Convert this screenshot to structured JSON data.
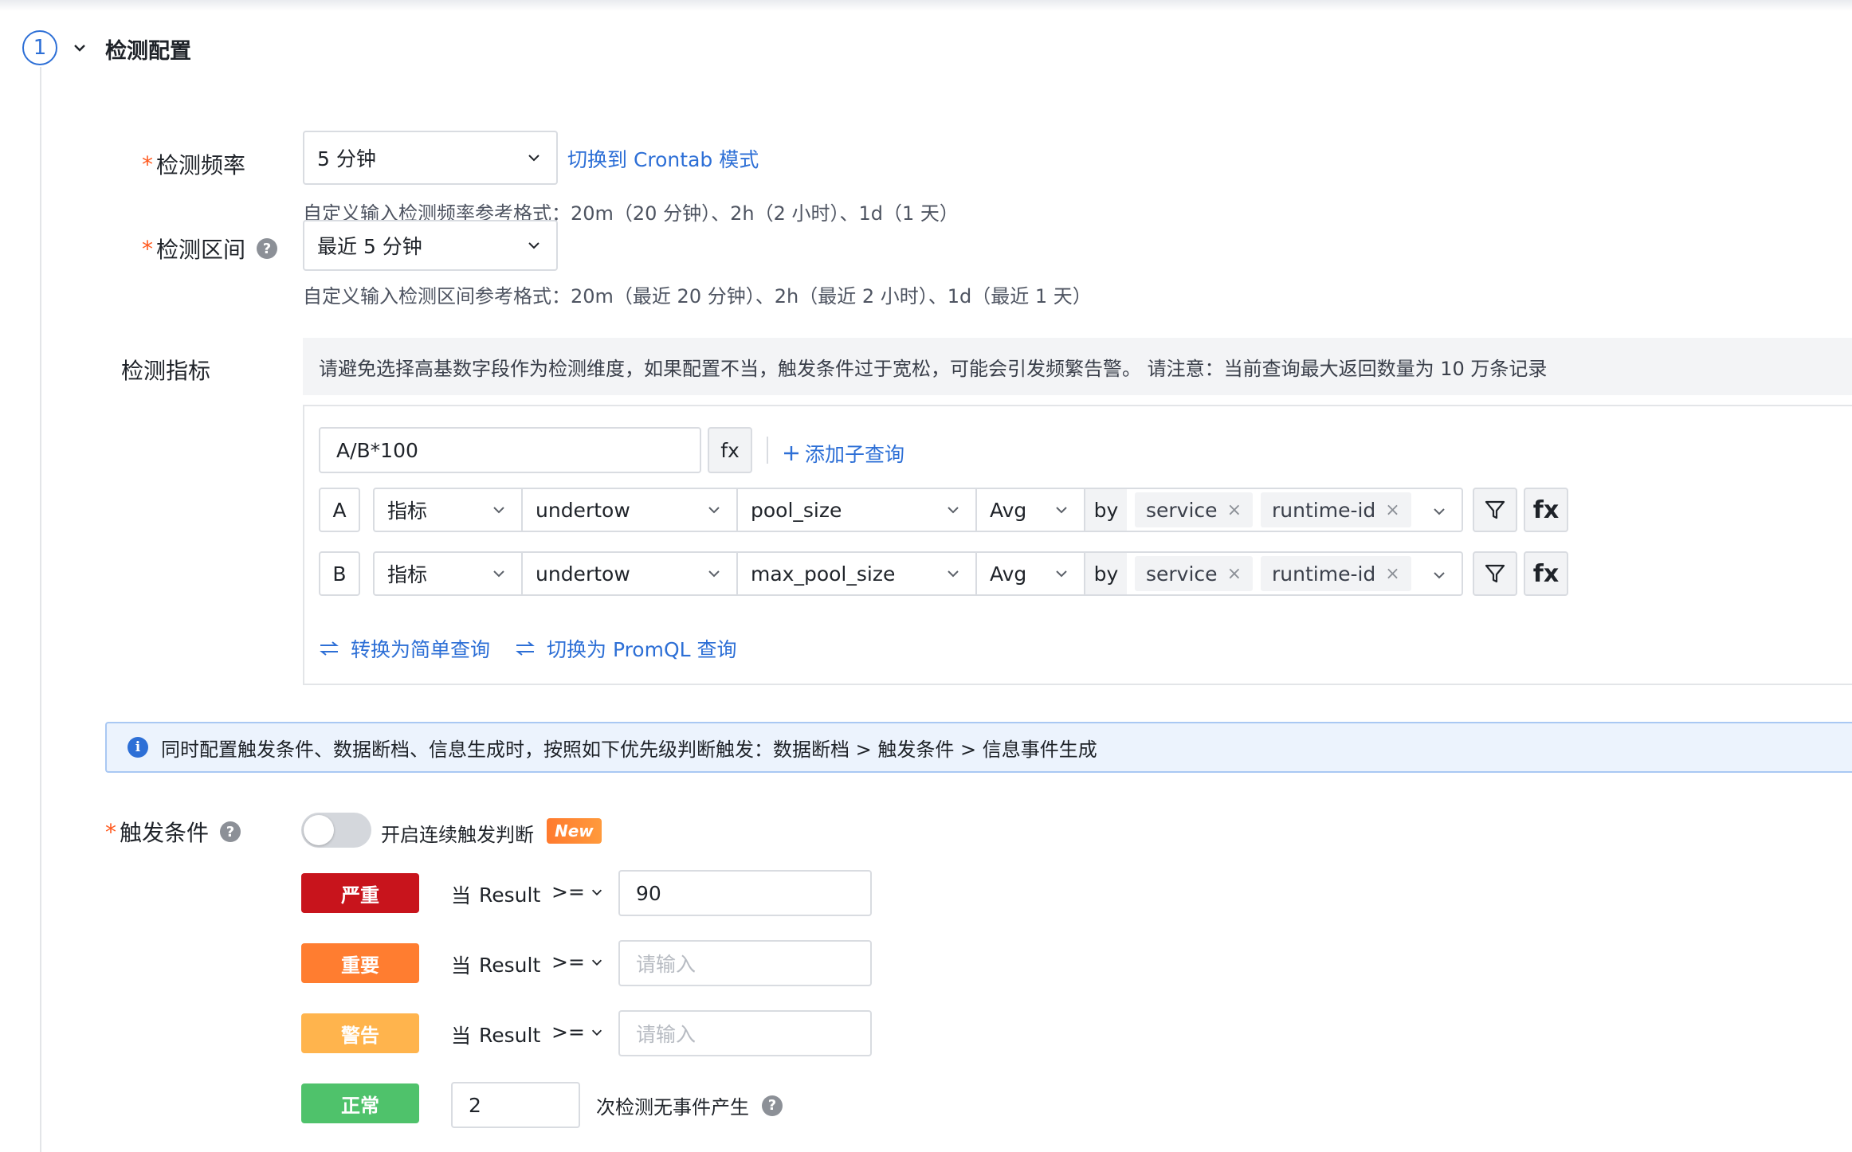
{
  "section": {
    "step": "1",
    "title": "检测配置"
  },
  "frequency": {
    "label": "检测频率",
    "value": "5 分钟",
    "switch_link": "切换到 Crontab 模式",
    "hint": "自定义输入检测频率参考格式：20m（20 分钟）、2h（2 小时）、1d（1 天）"
  },
  "range": {
    "label": "检测区间",
    "value": "最近 5 分钟",
    "hint": "自定义输入检测区间参考格式：20m（最近 20 分钟）、2h（最近 2 小时）、1d（最近 1 天）"
  },
  "metrics": {
    "label": "检测指标",
    "notice": "请避免选择高基数字段作为检测维度，如果配置不当，触发条件过于宽松，可能会引发频繁告警。 请注意：当前查询最大返回数量为 10 万条记录",
    "expression": "A/B*100",
    "fx_label": "fx",
    "add_subquery": "添加子查询",
    "queries": [
      {
        "letter": "A",
        "type": "指标",
        "measurement": "undertow",
        "field": "pool_size",
        "agg": "Avg",
        "by": "by",
        "tags": [
          "service",
          "runtime-id"
        ]
      },
      {
        "letter": "B",
        "type": "指标",
        "measurement": "undertow",
        "field": "max_pool_size",
        "agg": "Avg",
        "by": "by",
        "tags": [
          "service",
          "runtime-id"
        ]
      }
    ],
    "convert_simple": "转换为简单查询",
    "switch_promql": "切换为 PromQL 查询"
  },
  "info_bar": "同时配置触发条件、数据断档、信息生成时，按照如下优先级判断触发：数据断档 > 触发条件 > 信息事件生成",
  "trigger": {
    "label": "触发条件",
    "toggle_label": "开启连续触发判断",
    "new_badge": "New",
    "toggle_on": false,
    "rules": [
      {
        "level": "严重",
        "color": "#c8141c",
        "prefix": "当",
        "field": "Result",
        "op": ">=",
        "value": "90",
        "placeholder": "请输入"
      },
      {
        "level": "重要",
        "color": "#ff7d30",
        "prefix": "当",
        "field": "Result",
        "op": ">=",
        "value": "",
        "placeholder": "请输入"
      },
      {
        "level": "警告",
        "color": "#ffb44d",
        "prefix": "当",
        "field": "Result",
        "op": ">=",
        "value": "",
        "placeholder": "请输入"
      }
    ],
    "normal": {
      "level": "正常",
      "color": "#4fc26b",
      "count": "2",
      "suffix": "次检测无事件产生"
    }
  }
}
